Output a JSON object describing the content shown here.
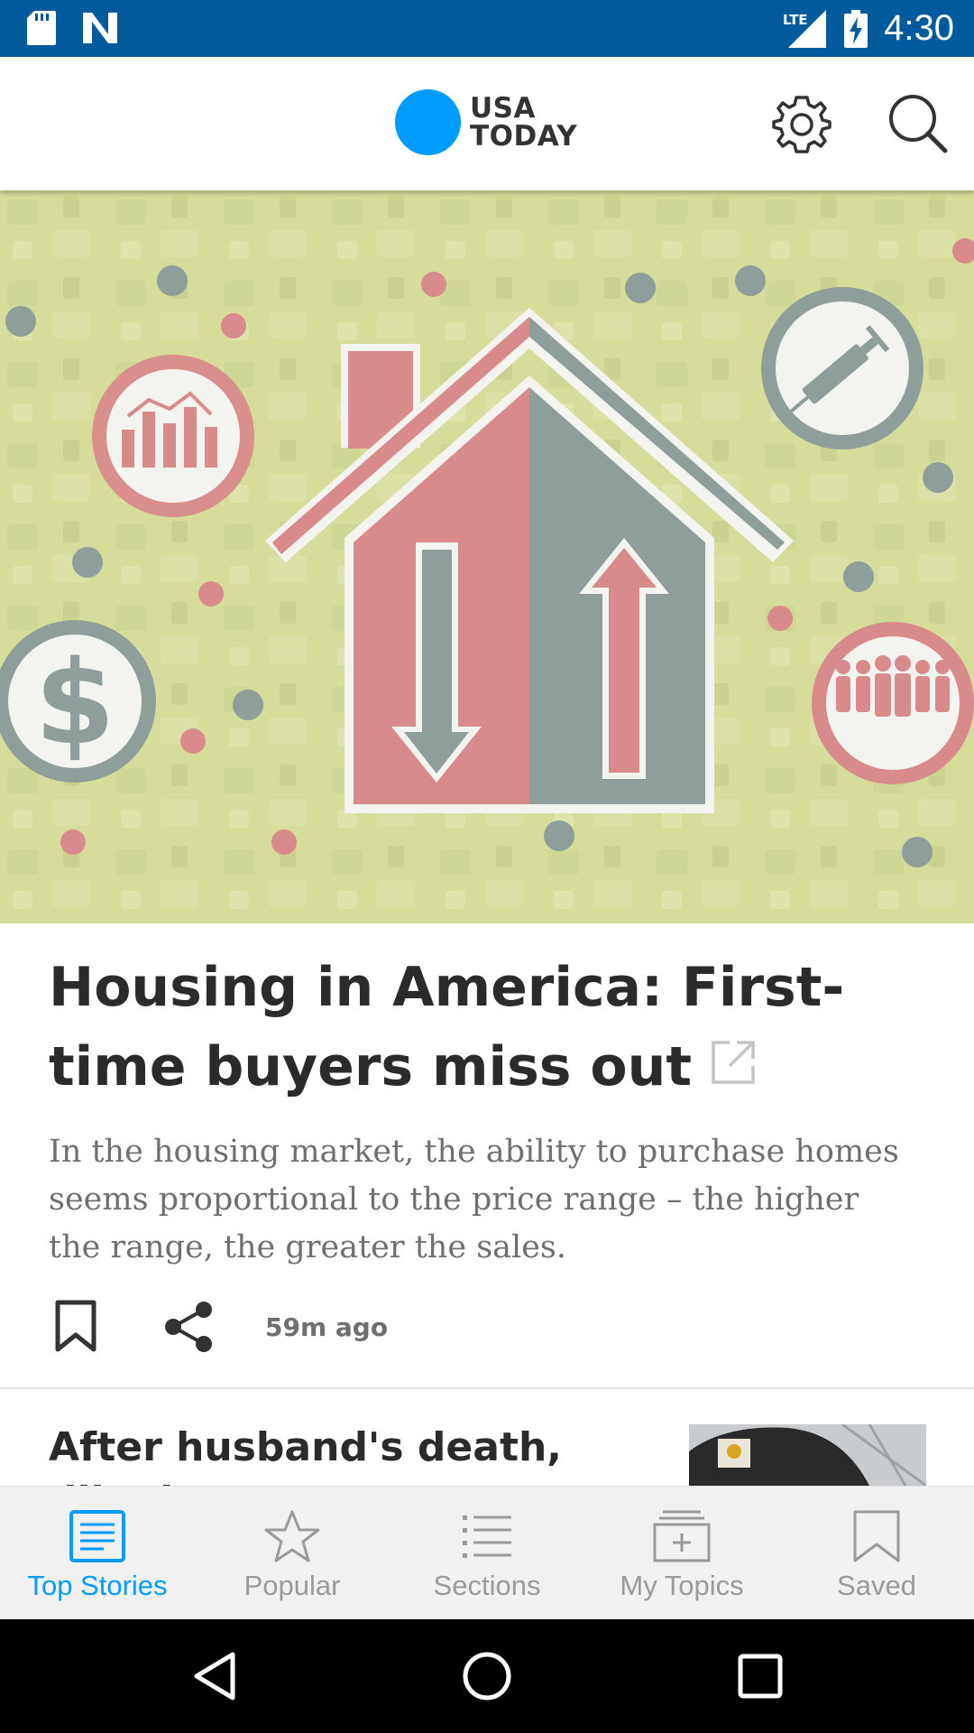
{
  "status_bar": {
    "time": "4:30",
    "network": "LTE",
    "left_icons": [
      "sd-card-icon",
      "app-n-icon"
    ],
    "right_icons": [
      "lte-signal-icon",
      "battery-charging-icon"
    ]
  },
  "header": {
    "logo_line1": "USA",
    "logo_line2": "TODAY",
    "logo_color": "#009bff",
    "icons": [
      "settings-gear-icon",
      "search-icon"
    ]
  },
  "hero": {
    "icons": [
      "house-up-down-arrows-illustration",
      "chart-icon",
      "syringe-icon",
      "dollar-icon",
      "people-icon"
    ],
    "background_color": "#d6dd9b"
  },
  "article": {
    "headline": "Housing in America:  First-time buyers miss out",
    "summary": "In the housing market, the ability to purchase homes seems proportional to the price range – the higher the range, the greater the sales.",
    "time_ago": "59m ago",
    "actions": [
      "bookmark-icon",
      "share-icon"
    ]
  },
  "next_article": {
    "headline": "After husband's death, Illinois woman says 'COVID"
  },
  "tabs": [
    {
      "label": "Top Stories",
      "icon": "top-stories-icon",
      "active": true
    },
    {
      "label": "Popular",
      "icon": "star-icon",
      "active": false
    },
    {
      "label": "Sections",
      "icon": "list-icon",
      "active": false
    },
    {
      "label": "My Topics",
      "icon": "my-topics-icon",
      "active": false
    },
    {
      "label": "Saved",
      "icon": "bookmark-icon",
      "active": false
    }
  ],
  "colors": {
    "status_bar": "#005a9c",
    "accent": "#009bff",
    "inactive_tab": "#9a9a9a",
    "headline_text": "#2b2b2b",
    "summary_text": "#6f6f6f"
  },
  "nav": [
    "back-button",
    "home-button",
    "recents-button"
  ]
}
